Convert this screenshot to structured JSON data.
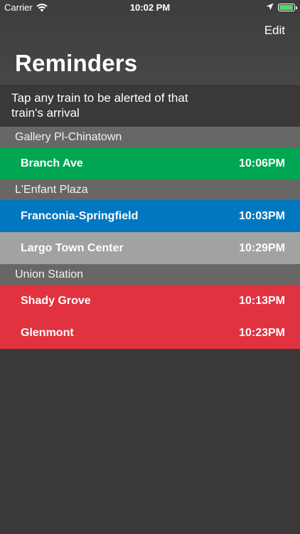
{
  "status_bar": {
    "carrier": "Carrier",
    "time": "10:02 PM",
    "icons": [
      "wifi-icon",
      "location-arrow-icon",
      "battery-icon"
    ]
  },
  "nav": {
    "edit_label": "Edit",
    "title": "Reminders"
  },
  "hint": "Tap any train to be alerted of that train's arrival",
  "colors": {
    "background": "#3a3839",
    "section_header": "#676767",
    "green_line": "#00a651",
    "blue_line": "#0078c1",
    "silver_line": "#a1a2a1",
    "red_line": "#e0323f",
    "battery": "#4cd964"
  },
  "stations": [
    {
      "name": "Gallery Pl-Chinatown",
      "trains": [
        {
          "destination": "Branch Ave",
          "time": "10:06PM",
          "color": "#00a651"
        }
      ]
    },
    {
      "name": "L'Enfant Plaza",
      "trains": [
        {
          "destination": "Franconia-Springfield",
          "time": "10:03PM",
          "color": "#0078c1"
        },
        {
          "destination": "Largo Town Center",
          "time": "10:29PM",
          "color": "#a1a2a1"
        }
      ]
    },
    {
      "name": "Union Station",
      "trains": [
        {
          "destination": "Shady Grove",
          "time": "10:13PM",
          "color": "#e0323f"
        },
        {
          "destination": "Glenmont",
          "time": "10:23PM",
          "color": "#e0323f"
        }
      ]
    }
  ]
}
